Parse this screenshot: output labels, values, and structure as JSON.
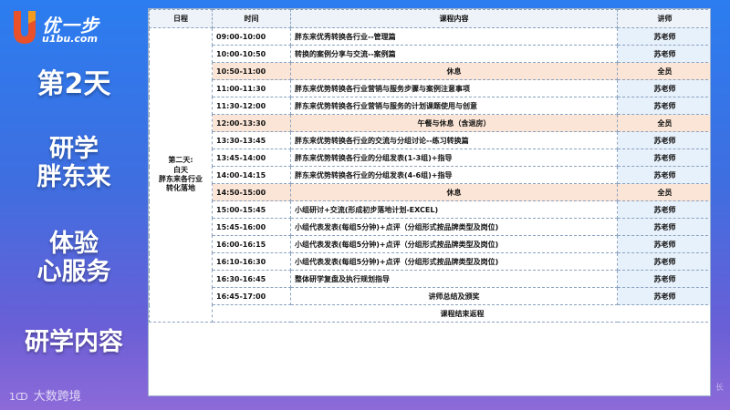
{
  "logo": {
    "mark": "U",
    "text": "优一步",
    "domain": "u1bu.com"
  },
  "sidebar": {
    "day": "第2天",
    "topic_line1": "研学",
    "topic_line2": "胖东来",
    "theme_line1": "体验",
    "theme_line2": "心服务",
    "section": "研学内容"
  },
  "footer": {
    "mark": "1ↀ",
    "brand": "大数跨境"
  },
  "watermark": "长",
  "table": {
    "headers": {
      "day": "日程",
      "time": "时间",
      "content": "课程内容",
      "teacher": "讲师"
    },
    "day_label": {
      "line1": "第二天:",
      "line2": "白天",
      "line3": "胖东来各行业",
      "line4": "转化落地"
    },
    "rows": [
      {
        "time": "09:00-10:00",
        "content": "胖东来优秀转换各行业--管理篇",
        "teacher": "苏老师",
        "rest": false
      },
      {
        "time": "10:00-10:50",
        "content": "转换的案例分享与交流--案例篇",
        "teacher": "苏老师",
        "rest": false
      },
      {
        "time": "10:50-11:00",
        "content": "休息",
        "teacher": "全员",
        "rest": true
      },
      {
        "time": "11:00-11:30",
        "content": "胖东来优势转换各行业营销与服务步骤与案例注意事项",
        "teacher": "苏老师",
        "rest": false
      },
      {
        "time": "11:30-12:00",
        "content": "胖东来优势转换各行业营销与服务的计划课题使用与创意",
        "teacher": "苏老师",
        "rest": false
      },
      {
        "time": "12:00-13:30",
        "content": "午餐与休息（含退房）",
        "teacher": "全员",
        "rest": true
      },
      {
        "time": "13:30-13:45",
        "content": "胖东来优势转换各行业的交流与分组讨论--练习转换篇",
        "teacher": "苏老师",
        "rest": false
      },
      {
        "time": "13:45-14:00",
        "content": "胖东来优势转换各行业的分组发表(1-3组)+指导",
        "teacher": "苏老师",
        "rest": false
      },
      {
        "time": "14:00-14:15",
        "content": "胖东来优势转换各行业的分组发表(4-6组)+指导",
        "teacher": "苏老师",
        "rest": false
      },
      {
        "time": "14:50-15:00",
        "content": "休息",
        "teacher": "全员",
        "rest": true
      },
      {
        "time": "15:00-15:45",
        "content": "小组研讨+交流(形成初步落地计划-EXCEL)",
        "teacher": "苏老师",
        "rest": false
      },
      {
        "time": "15:45-16:00",
        "content": "小组代表发表(每组5分钟)+点评（分组形式按品牌类型及岗位)",
        "teacher": "苏老师",
        "rest": false
      },
      {
        "time": "16:00-16:15",
        "content": "小组代表发表(每组5分钟)+点评（分组形式按品牌类型及岗位)",
        "teacher": "苏老师",
        "rest": false
      },
      {
        "time": "16:10-16:30",
        "content": "小组代表发表(每组5分钟)+点评（分组形式按品牌类型及岗位)",
        "teacher": "苏老师",
        "rest": false
      },
      {
        "time": "16:30-16:45",
        "content": "整体研学复盘及执行规划指导",
        "teacher": "苏老师",
        "rest": false
      },
      {
        "time": "16:45-17:00",
        "content": "讲师总结及颁奖",
        "teacher": "苏老师",
        "rest": false,
        "center": true
      }
    ],
    "closing": "课程结束返程"
  },
  "colors": {
    "rest_row": "#fbe5d6",
    "teacher_cell": "#e7f1fb",
    "header": "#eef3fa",
    "bg_top": "#2b7df0",
    "bg_bottom": "#8d6ad8"
  }
}
